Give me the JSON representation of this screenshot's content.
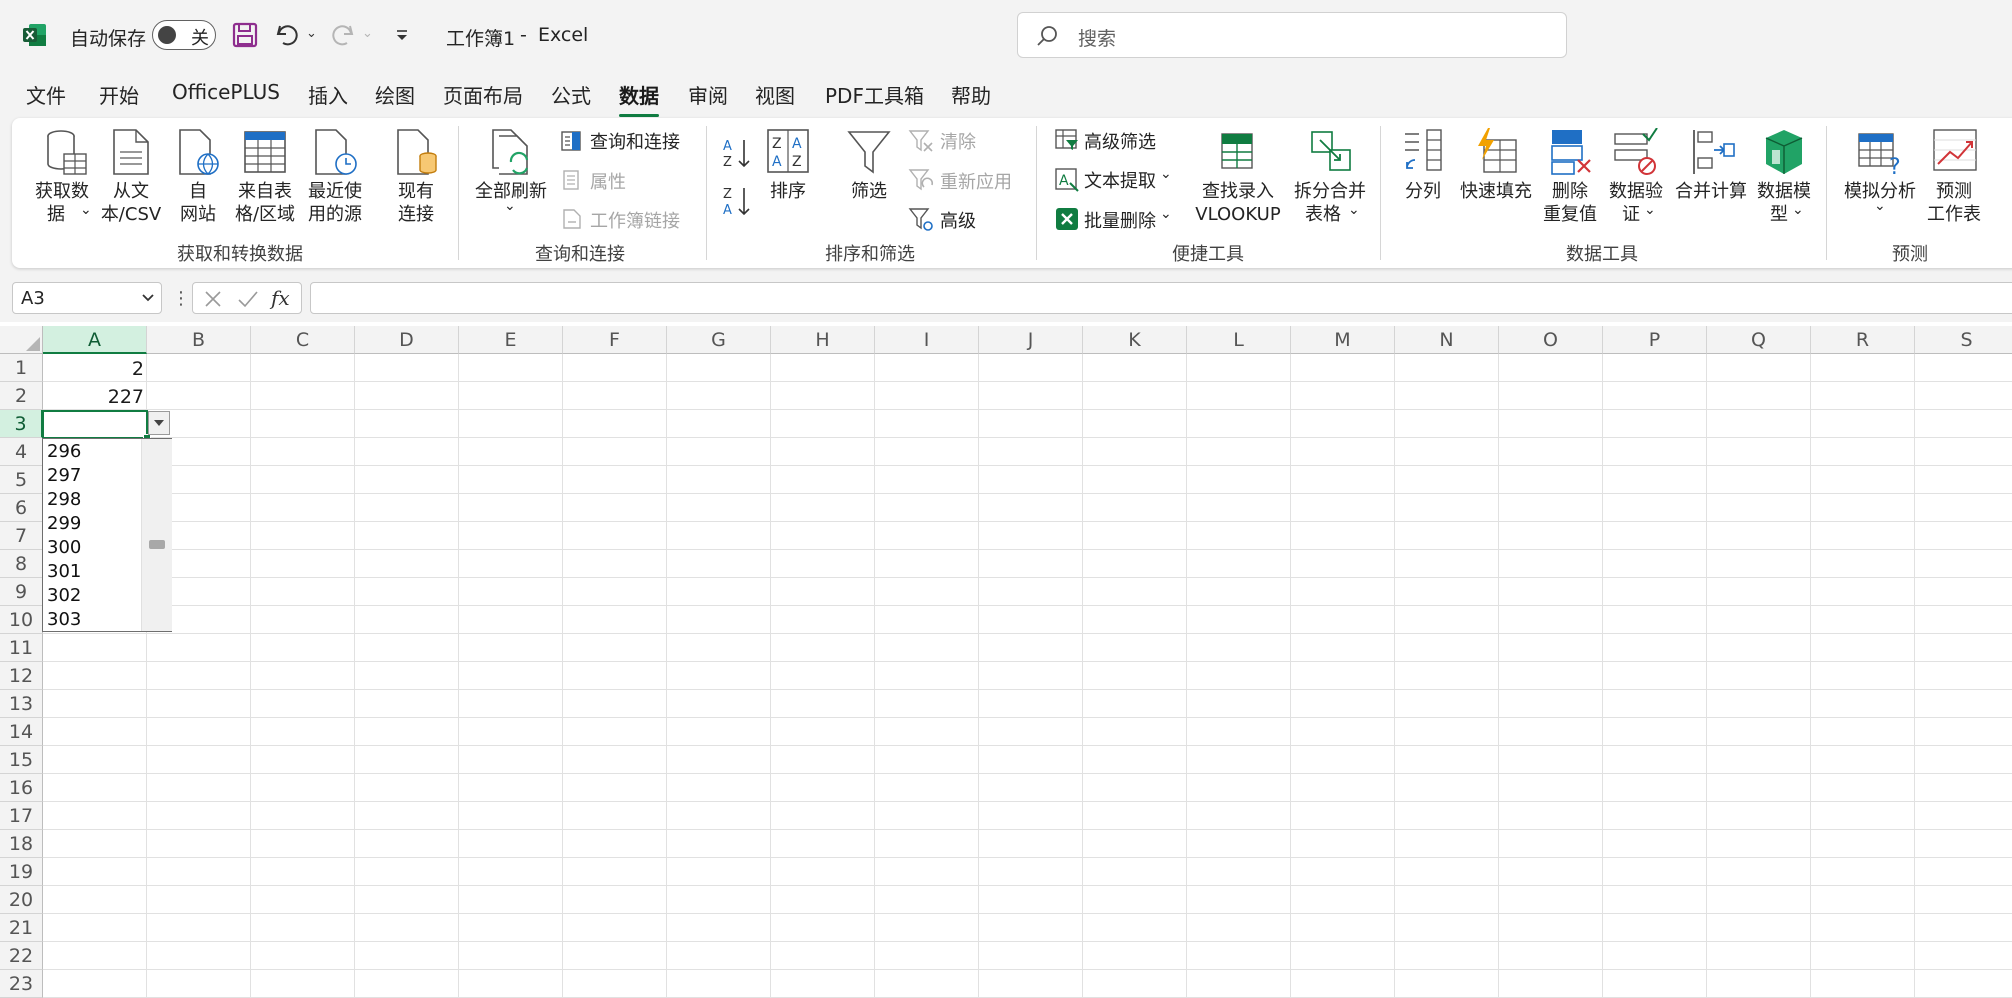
{
  "titlebar": {
    "autosave_label": "自动保存",
    "autosave_state": "关",
    "doc_title": "工作簿1",
    "separator": "-",
    "app_name": "Excel",
    "search_placeholder": "搜索"
  },
  "menu_tabs": [
    "文件",
    "开始",
    "OfficePLUS",
    "插入",
    "绘图",
    "页面布局",
    "公式",
    "数据",
    "审阅",
    "视图",
    "PDF工具箱",
    "帮助"
  ],
  "active_tab": "数据",
  "ribbon": {
    "get_data": [
      "获取数",
      "据"
    ],
    "from_text": [
      "从文",
      "本/CSV"
    ],
    "from_web": [
      "自",
      "网站"
    ],
    "from_table": [
      "来自表",
      "格/区域"
    ],
    "recent_sources": [
      "最近使",
      "用的源"
    ],
    "existing_conn": [
      "现有",
      "连接"
    ],
    "group_get": "获取和转换数据",
    "refresh_all": "全部刷新",
    "queries_conn": "查询和连接",
    "properties": "属性",
    "workbook_links": "工作簿链接",
    "group_queries": "查询和连接",
    "sort": "排序",
    "filter": "筛选",
    "clear": "清除",
    "reapply": "重新应用",
    "advanced": "高级",
    "group_sort": "排序和筛选",
    "adv_filter": "高级筛选",
    "text_extract": "文本提取",
    "batch_delete": "批量删除",
    "vlookup": [
      "查找录入",
      "VLOOKUP"
    ],
    "split_merge": [
      "拆分合并",
      "表格"
    ],
    "group_tools": "便捷工具",
    "text_to_cols": "分列",
    "flash_fill": "快速填充",
    "remove_dup": [
      "删除",
      "重复值"
    ],
    "data_valid": [
      "数据验",
      "证"
    ],
    "consolidate": "合并计算",
    "data_model": [
      "数据模",
      "型"
    ],
    "group_datatools": "数据工具",
    "what_if": "模拟分析",
    "forecast": [
      "预测",
      "工作表"
    ],
    "group_forecast": "预测"
  },
  "formula_bar": {
    "name_box": "A3",
    "fx": "fx",
    "formula": ""
  },
  "columns": [
    "A",
    "B",
    "C",
    "D",
    "E",
    "F",
    "G",
    "H",
    "I",
    "J",
    "K",
    "L",
    "M",
    "N",
    "O",
    "P",
    "Q",
    "R",
    "S"
  ],
  "rows": [
    "1",
    "2",
    "3",
    "4",
    "5",
    "6",
    "7",
    "8",
    "9",
    "10",
    "11",
    "12",
    "13",
    "14",
    "15",
    "16",
    "17",
    "18",
    "19",
    "20",
    "21",
    "22",
    "23"
  ],
  "cells": {
    "A1": "2",
    "A2": "227"
  },
  "dropdown_items": [
    "296",
    "297",
    "298",
    "299",
    "300",
    "301",
    "302",
    "303"
  ],
  "colors": {
    "accent": "#107c41",
    "chrome": "#f3f3f3"
  }
}
